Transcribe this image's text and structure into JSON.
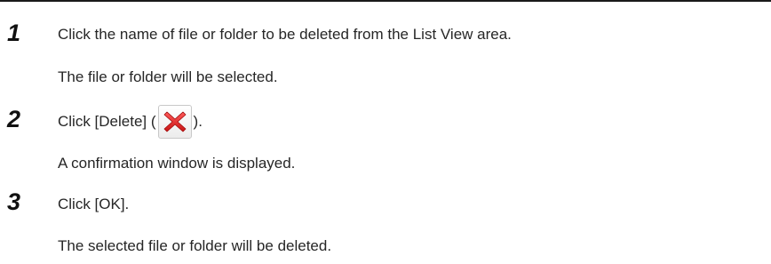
{
  "steps": [
    {
      "number": "1",
      "instruction": "Click the name of file or folder to be deleted from the List View area.",
      "result": "The file or folder will be selected."
    },
    {
      "number": "2",
      "instruction_before": "Click [Delete] (",
      "instruction_after": ").",
      "icon": "delete-x-icon",
      "icon_color": "#e02020",
      "result": "A confirmation window is displayed."
    },
    {
      "number": "3",
      "instruction": "Click [OK].",
      "result": "The selected file or folder will be deleted."
    }
  ]
}
